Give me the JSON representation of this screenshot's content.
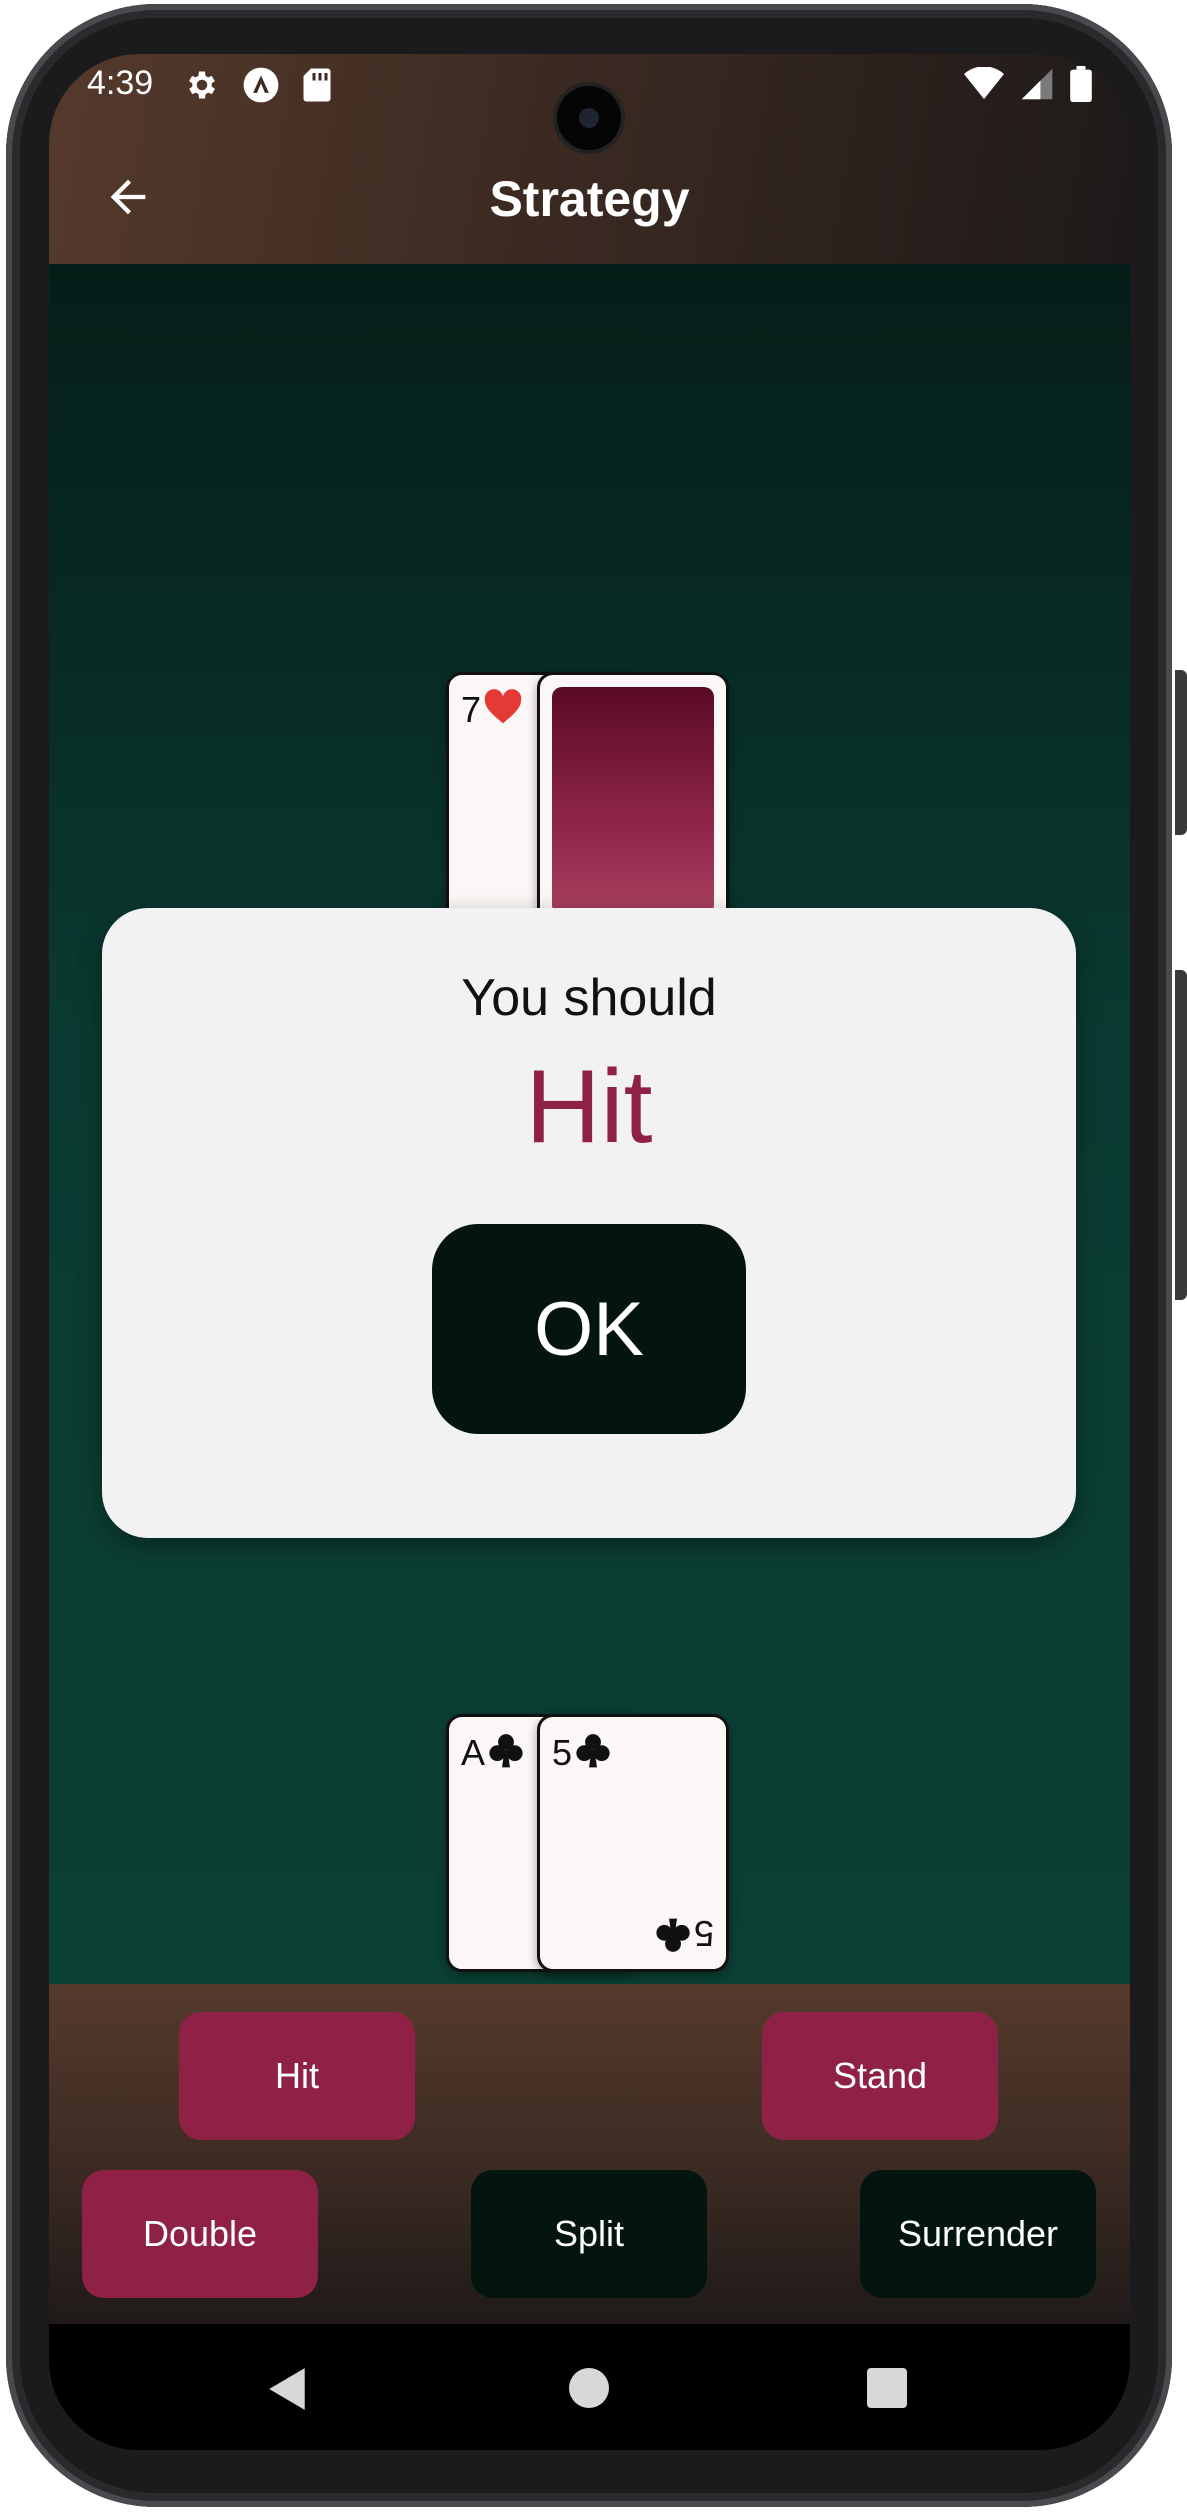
{
  "status_bar": {
    "time": "4:39",
    "icons_left": [
      "settings-icon",
      "app-notification-icon",
      "sd-card-icon"
    ],
    "icons_right": [
      "wifi-icon",
      "signal-icon",
      "battery-icon"
    ]
  },
  "app_bar": {
    "title": "Strategy",
    "back_icon": "arrow-left-icon"
  },
  "dealer_hand": {
    "cards": [
      {
        "rank": "7",
        "suit": "♥",
        "suit_color": "#e53935",
        "face_up": true
      },
      {
        "face_up": false
      }
    ]
  },
  "dialog": {
    "heading": "You should",
    "action": "Hit",
    "action_color": "#8f2147",
    "ok_label": "OK"
  },
  "player_hand": {
    "cards": [
      {
        "rank": "A",
        "suit": "♣",
        "face_up": true
      },
      {
        "rank": "5",
        "suit": "♣",
        "face_up": true
      }
    ]
  },
  "actions": {
    "hit": "Hit",
    "stand": "Stand",
    "double": "Double",
    "split": "Split",
    "surrender": "Surrender"
  },
  "colors": {
    "accent": "#8f2147",
    "dark_button": "#04150f",
    "table_green": "#0a3a31"
  },
  "nav_bar": {
    "back": "nav-back-icon",
    "home": "nav-home-icon",
    "recents": "nav-recents-icon"
  }
}
